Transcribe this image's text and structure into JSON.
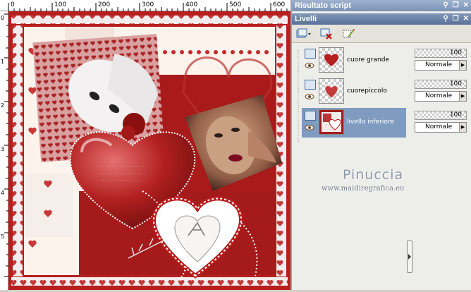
{
  "ruler": {
    "top_labels": [
      "0",
      "100",
      "200",
      "300",
      "400",
      "500",
      "600"
    ],
    "left_labels": [
      "0",
      "1",
      "2",
      "3",
      "4",
      "5"
    ]
  },
  "script_panel": {
    "title": "Risultato script"
  },
  "layers_panel": {
    "title": "Livelli",
    "toolbar_icons": [
      "new-layer-icon",
      "delete-layer-icon",
      "properties-icon"
    ],
    "layers": [
      {
        "name": "cuore grande",
        "opacity": "100",
        "blend": "Normale",
        "selected": false
      },
      {
        "name": "cuorepiccolo",
        "opacity": "100",
        "blend": "Normale",
        "selected": false
      },
      {
        "name": "livello inferiore",
        "opacity": "100",
        "blend": "Normale",
        "selected": true
      }
    ]
  },
  "watermark": {
    "name": "Pinuccia",
    "site": "www.maidiregrafica.eu"
  },
  "colors": {
    "accent": "#b01c1c",
    "panel_title": "#5a7197",
    "selection": "#7f9cc0"
  }
}
